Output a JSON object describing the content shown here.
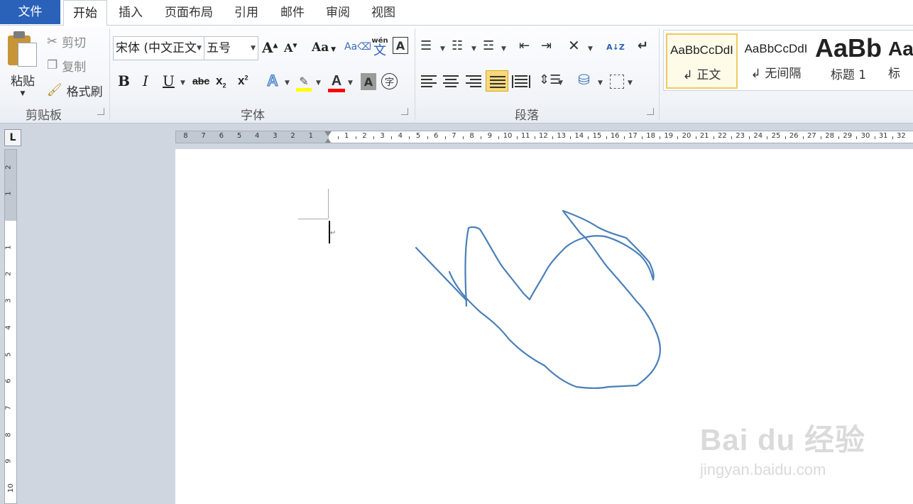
{
  "tabs": {
    "file": "文件",
    "home": "开始",
    "insert": "插入",
    "layout": "页面布局",
    "references": "引用",
    "mailings": "邮件",
    "review": "审阅",
    "view": "视图"
  },
  "clipboard": {
    "paste": "粘贴",
    "cut": "剪切",
    "copy": "复制",
    "format_painter": "格式刷",
    "group": "剪贴板"
  },
  "font": {
    "name": "宋体 (中文正文",
    "size": "五号",
    "group": "字体",
    "grow_icon": "A",
    "shrink_icon": "A",
    "case_icon": "Aa",
    "bold": "B",
    "italic": "I",
    "underline": "U",
    "strike": "abc",
    "subscript": "x",
    "superscript": "x",
    "wen": "wén",
    "wen_char": "文",
    "border_char": "A",
    "shade_char": "A",
    "enclose_char": "字",
    "highlight_color": "#ffff00",
    "font_color": "#ff0000"
  },
  "paragraph": {
    "group": "段落",
    "sort": "A↓Z"
  },
  "styles": [
    {
      "sample": "AaBbCcDdI",
      "name": "↲ 正文"
    },
    {
      "sample": "AaBbCcDdI",
      "name": "↲ 无间隔"
    },
    {
      "sample": "AaBb",
      "name": "标题 1"
    },
    {
      "sample": "AaI",
      "name": "标"
    }
  ],
  "ruler": {
    "corner": "L",
    "left_numbers": [
      "8",
      "7",
      "6",
      "5",
      "4",
      "3",
      "2",
      "1"
    ],
    "right_numbers": [
      "1",
      "2",
      "3",
      "4",
      "5",
      "6",
      "7",
      "8",
      "9",
      "10",
      "11",
      "12",
      "13",
      "14",
      "15",
      "16",
      "17",
      "18",
      "19",
      "20",
      "21",
      "22",
      "23",
      "24",
      "25",
      "26",
      "27",
      "28",
      "29",
      "30",
      "31",
      "32"
    ],
    "vertical_top": [
      "2",
      "1"
    ],
    "vertical_numbers": [
      "1",
      "2",
      "3",
      "4",
      "5",
      "6",
      "7",
      "8",
      "9",
      "10"
    ]
  },
  "document": {
    "para_mark": "↵",
    "ink_color": "#4a7fb8"
  },
  "watermark": {
    "main": "Bai du 经验",
    "sub": "jingyan.baidu.com"
  }
}
